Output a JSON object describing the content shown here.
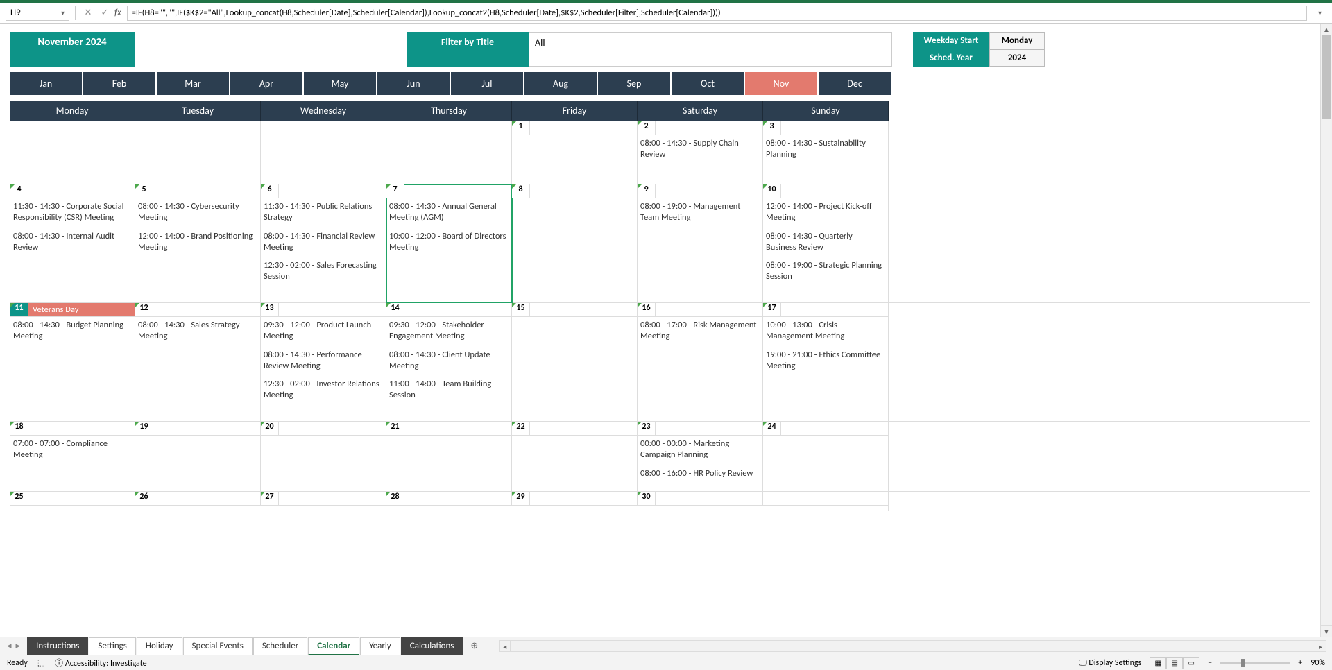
{
  "formula_bar": {
    "cell_ref": "H9",
    "formula": "=IF(H8=\"\",\"\",IF($K$2=\"All\",Lookup_concat(H8,Scheduler[Date],Scheduler[Calendar]),Lookup_concat2(H8,Scheduler[Date],$K$2,Scheduler[Filter],Scheduler[Calendar])))"
  },
  "header": {
    "title": "November 2024",
    "filter_label": "Filter by Title",
    "filter_value": "All"
  },
  "side_panel": {
    "weekday_start_label": "Weekday Start",
    "weekday_start_value": "Monday",
    "sched_year_label": "Sched. Year",
    "sched_year_value": "2024"
  },
  "months": [
    "Jan",
    "Feb",
    "Mar",
    "Apr",
    "May",
    "Jun",
    "Jul",
    "Aug",
    "Sep",
    "Oct",
    "Nov",
    "Dec"
  ],
  "active_month_index": 10,
  "day_headers": [
    "Monday",
    "Tuesday",
    "Wednesday",
    "Thursday",
    "Friday",
    "Saturday",
    "Sunday"
  ],
  "calendar_rows": [
    {
      "cells": [
        {
          "date": "",
          "events": []
        },
        {
          "date": "",
          "events": []
        },
        {
          "date": "",
          "events": []
        },
        {
          "date": "",
          "events": []
        },
        {
          "date": "1",
          "events": []
        },
        {
          "date": "2",
          "events": [
            "08:00 - 14:30 - Supply Chain Review"
          ]
        },
        {
          "date": "3",
          "events": [
            "08:00 - 14:30 - Sustainability Planning"
          ]
        }
      ]
    },
    {
      "cells": [
        {
          "date": "4",
          "events": [
            "11:30 - 14:30 - Corporate Social Responsibility (CSR) Meeting",
            "08:00 - 14:30 - Internal Audit Review"
          ]
        },
        {
          "date": "5",
          "events": [
            "08:00 - 14:30 - Cybersecurity Meeting",
            "12:00 - 14:00 - Brand Positioning Meeting"
          ]
        },
        {
          "date": "6",
          "events": [
            "11:30 - 14:30 - Public Relations Strategy",
            "08:00 - 14:30 - Financial Review Meeting",
            "12:30 - 02:00 - Sales Forecasting Session"
          ]
        },
        {
          "date": "7",
          "selected": true,
          "events": [
            "08:00 - 14:30 - Annual General Meeting (AGM)",
            "10:00 - 12:00 - Board of Directors Meeting"
          ]
        },
        {
          "date": "8",
          "events": []
        },
        {
          "date": "9",
          "events": [
            "08:00 - 19:00 - Management Team Meeting"
          ]
        },
        {
          "date": "10",
          "events": [
            "12:00 - 14:00 - Project Kick-off Meeting",
            "08:00 - 14:30 - Quarterly Business Review",
            "08:00 - 19:00 - Strategic Planning Session"
          ]
        }
      ]
    },
    {
      "cells": [
        {
          "date": "11",
          "today": true,
          "holiday": "Veterans Day",
          "events": [
            "08:00 - 14:30 - Budget Planning Meeting"
          ]
        },
        {
          "date": "12",
          "events": [
            "08:00 - 14:30 - Sales Strategy Meeting"
          ]
        },
        {
          "date": "13",
          "events": [
            "09:30 - 12:00 - Product Launch Meeting",
            "08:00 - 14:30 - Performance Review Meeting",
            "12:30 - 02:00 - Investor Relations Meeting"
          ]
        },
        {
          "date": "14",
          "events": [
            "09:30 - 12:00 - Stakeholder Engagement Meeting",
            "08:00 - 14:30 - Client Update Meeting",
            "11:00 - 14:00 - Team Building Session"
          ]
        },
        {
          "date": "15",
          "events": []
        },
        {
          "date": "16",
          "events": [
            "08:00 - 17:00 - Risk Management Meeting"
          ]
        },
        {
          "date": "17",
          "events": [
            "10:00 - 13:00 - Crisis Management Meeting",
            "19:00 - 21:00 - Ethics Committee Meeting"
          ]
        }
      ]
    },
    {
      "cells": [
        {
          "date": "18",
          "events": [
            "07:00 - 07:00 - Compliance Meeting"
          ]
        },
        {
          "date": "19",
          "events": []
        },
        {
          "date": "20",
          "events": []
        },
        {
          "date": "21",
          "events": []
        },
        {
          "date": "22",
          "events": []
        },
        {
          "date": "23",
          "events": [
            "00:00 - 00:00 - Marketing Campaign Planning",
            "08:00 - 16:00 - HR Policy Review"
          ]
        },
        {
          "date": "24",
          "events": []
        }
      ]
    },
    {
      "cells": [
        {
          "date": "25",
          "partial": true,
          "events": []
        },
        {
          "date": "26",
          "partial": true,
          "events": []
        },
        {
          "date": "27",
          "partial": true,
          "events": []
        },
        {
          "date": "28",
          "partial": true,
          "events": []
        },
        {
          "date": "29",
          "partial": true,
          "events": []
        },
        {
          "date": "30",
          "partial": true,
          "events": []
        },
        {
          "date": "",
          "events": []
        }
      ]
    }
  ],
  "sheet_tabs": [
    {
      "name": "Instructions",
      "style": "dark"
    },
    {
      "name": "Settings",
      "style": "light"
    },
    {
      "name": "Holiday",
      "style": "light"
    },
    {
      "name": "Special Events",
      "style": "light"
    },
    {
      "name": "Scheduler",
      "style": "light"
    },
    {
      "name": "Calendar",
      "style": "active"
    },
    {
      "name": "Yearly",
      "style": "light"
    },
    {
      "name": "Calculations",
      "style": "dark"
    }
  ],
  "status_bar": {
    "ready": "Ready",
    "accessibility": "Accessibility: Investigate",
    "display_settings": "Display Settings",
    "zoom": "90%"
  }
}
